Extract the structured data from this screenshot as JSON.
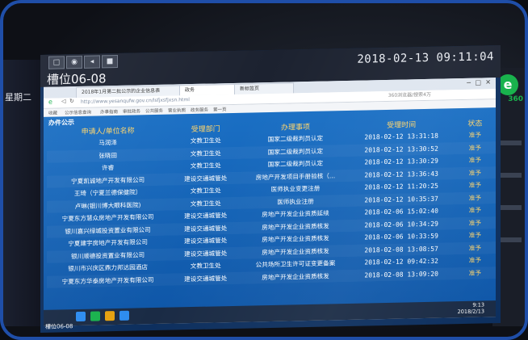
{
  "left_screen": {
    "label": "星期二"
  },
  "main_window": {
    "title": "槽位06-08",
    "clock": "2018-02-13 09:11:04",
    "toolbar_buttons": [
      "□",
      "◉",
      "◂",
      "■"
    ]
  },
  "browser": {
    "tabs": [
      "2018年1月第二批公示的企业信息表",
      "政务",
      "新标签页"
    ],
    "address": "http://www.yesanqufw.gov.cn/lsfjxsfjxsn.html",
    "search_hint": "360浏览器/搜索4万",
    "favorites": [
      "收藏",
      "公示信息查询",
      "办事指南",
      "审批政务",
      "公共服务",
      "营业执照",
      "政务服务",
      "第一页"
    ]
  },
  "content": {
    "section_title": "办件公示",
    "columns": [
      "申请人/单位名称",
      "受理部门",
      "办理事项",
      "受理时间",
      "状态"
    ],
    "rows": [
      [
        "马润泽",
        "文教卫生处",
        "国家二级裁判员认定",
        "2018-02-12 13:31:18",
        "准予"
      ],
      [
        "张晓田",
        "文教卫生处",
        "国家二级裁判员认定",
        "2018-02-12 13:30:52",
        "准予"
      ],
      [
        "许睿",
        "文教卫生处",
        "国家二级裁判员认定",
        "2018-02-12 13:30:29",
        "准予"
      ],
      [
        "宁夏凯诚地产开发有限公司",
        "建设交通城管处",
        "房地产开发项目手册验核（...",
        "2018-02-12 13:36:43",
        "准予"
      ],
      [
        "王琦（宁夏兰德保健院）",
        "文教卫生处",
        "医师执业变更注册",
        "2018-02-12 11:20:25",
        "准予"
      ],
      [
        "卢琳(银川博大眼科医院)",
        "文教卫生处",
        "医师执业注册",
        "2018-02-12 10:35:37",
        "准予"
      ],
      [
        "宁夏东方慧众房地产开发有限公司",
        "建设交通城管处",
        "房地产开发企业资质延续",
        "2018-02-06 15:02:40",
        "准予"
      ],
      [
        "银川嘉兴绿城投资置业有限公司",
        "建设交通城管处",
        "房地产开发企业资质核发",
        "2018-02-06 10:34:29",
        "准予"
      ],
      [
        "宁夏建宇房地产开发有限公司",
        "建设交通城管处",
        "房地产开发企业资质核发",
        "2018-02-06 10:33:59",
        "准予"
      ],
      [
        "银川顺德投资置业有限公司",
        "建设交通城管处",
        "房地产开发企业资质核发",
        "2018-02-08 13:08:57",
        "准予"
      ],
      [
        "银川市兴庆区鼎力邦达园酒店",
        "文教卫生处",
        "公共场所卫生许可证变更备案",
        "2018-02-12 09:42:32",
        "准予"
      ],
      [
        "宁夏东方华泰房地产开发有限公司",
        "建设交通城管处",
        "房地产开发企业资质核发",
        "2018-02-08 13:09:20",
        "准予"
      ]
    ]
  },
  "taskbar": {
    "label": "槽位06-08",
    "time": "9:13",
    "date": "2018/2/13"
  },
  "right_screen": {
    "brand": "360"
  }
}
